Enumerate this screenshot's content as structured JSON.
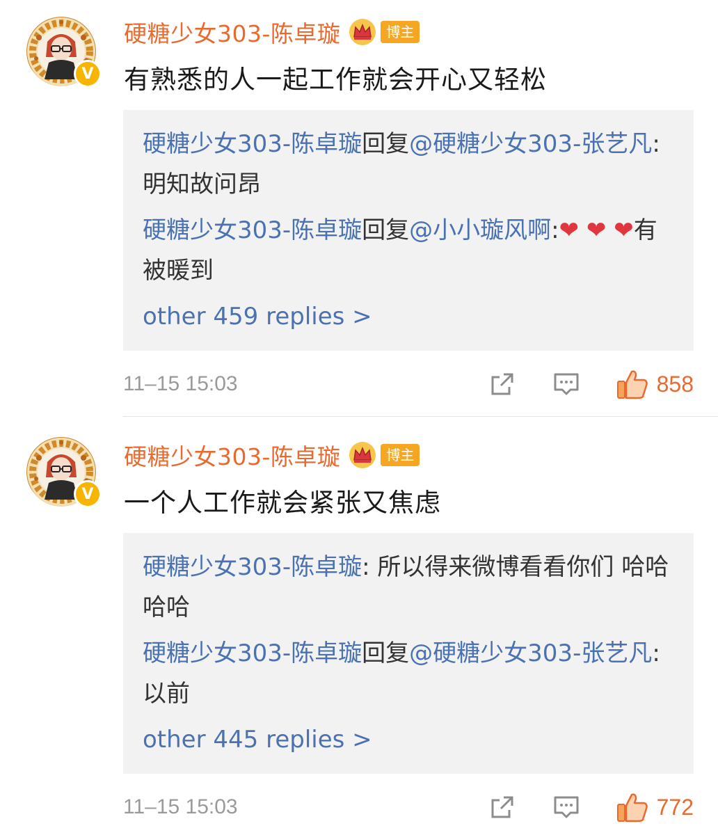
{
  "comments": [
    {
      "username": "硬糖少女303-陈卓璇",
      "badge": "博主",
      "content": "有熟悉的人一起工作就会开心又轻松",
      "replies": [
        {
          "author": "硬糖少女303-陈卓璇",
          "mid": "回复",
          "target": "@硬糖少女303-张艺凡",
          "text": ":明知故问昂"
        },
        {
          "author": "硬糖少女303-陈卓璇",
          "mid": "回复",
          "target": "@小小璇风啊",
          "text": ":",
          "hearts": "❤ ❤ ❤",
          "tail": "有被暖到"
        }
      ],
      "more_replies": "other 459 replies >",
      "timestamp": "11–15 15:03",
      "likes": "858"
    },
    {
      "username": "硬糖少女303-陈卓璇",
      "badge": "博主",
      "content": "一个人工作就会紧张又焦虑",
      "replies": [
        {
          "author": "硬糖少女303-陈卓璇",
          "mid": "",
          "target": "",
          "text": ": 所以得来微博看看你们 哈哈哈哈"
        },
        {
          "author": "硬糖少女303-陈卓璇",
          "mid": "回复",
          "target": "@硬糖少女303-张艺凡",
          "text": ":以前"
        }
      ],
      "more_replies": "other 445 replies >",
      "timestamp": "11–15 15:03",
      "likes": "772"
    }
  ],
  "icons": {
    "verified": "V",
    "crown": "crown-icon",
    "share": "share-icon",
    "comment": "comment-icon",
    "like": "thumbs-up-icon"
  },
  "colors": {
    "username": "#e86a2f",
    "link": "#4a72b3",
    "badge": "#f5a623",
    "heart": "#e0373f",
    "time": "#9a9a9a"
  }
}
